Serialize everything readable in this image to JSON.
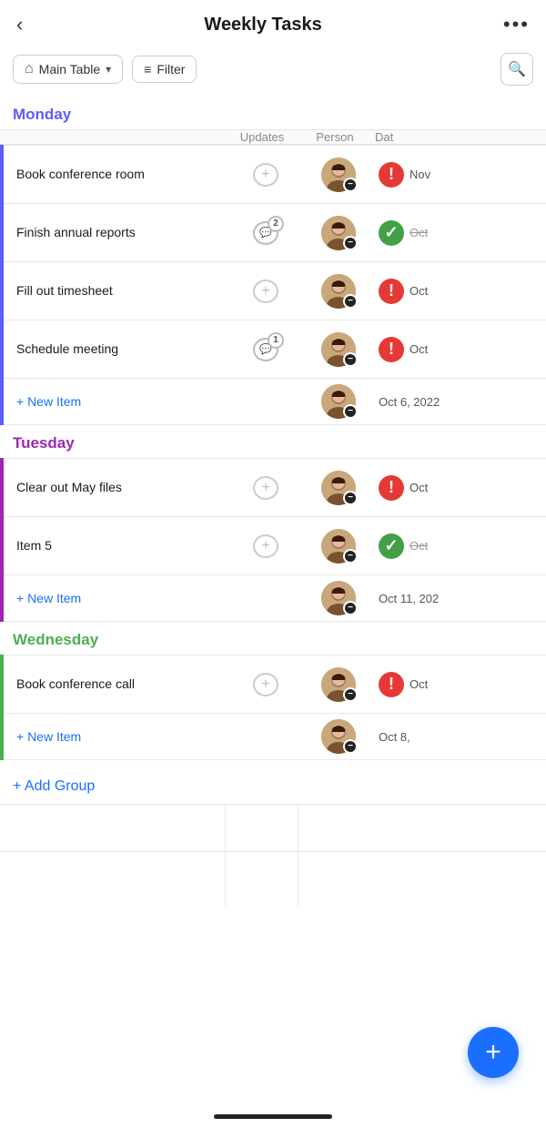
{
  "header": {
    "title": "Weekly Tasks",
    "back_label": "‹",
    "more_label": "•••"
  },
  "toolbar": {
    "table_label": "Main Table",
    "filter_label": "Filter",
    "search_icon": "search"
  },
  "columns": {
    "updates": "Updates",
    "person": "Person",
    "date": "Dat"
  },
  "groups": [
    {
      "id": "monday",
      "label": "Monday",
      "color_class": "monday",
      "items": [
        {
          "name": "Book conference room",
          "updates": 0,
          "status": "red",
          "date_text": "Nov",
          "date_strikethrough": false
        },
        {
          "name": "Finish annual reports",
          "updates": 2,
          "status": "green",
          "date_text": "Oct",
          "date_strikethrough": true
        },
        {
          "name": "Fill out timesheet",
          "updates": 0,
          "status": "red",
          "date_text": "Oct",
          "date_strikethrough": false
        },
        {
          "name": "Schedule meeting",
          "updates": 1,
          "status": "red",
          "date_text": "Oct",
          "date_strikethrough": false
        }
      ],
      "new_item_label": "+ New Item",
      "new_item_date": "Oct 6, 2022"
    },
    {
      "id": "tuesday",
      "label": "Tuesday",
      "color_class": "tuesday",
      "items": [
        {
          "name": "Clear out May files",
          "updates": 0,
          "status": "red",
          "date_text": "Oct",
          "date_strikethrough": false
        },
        {
          "name": "Item 5",
          "updates": 0,
          "status": "green",
          "date_text": "Oct",
          "date_strikethrough": true
        }
      ],
      "new_item_label": "+ New Item",
      "new_item_date": "Oct 11, 202"
    },
    {
      "id": "wednesday",
      "label": "Wednesday",
      "color_class": "wednesday",
      "items": [
        {
          "name": "Book conference call",
          "updates": 0,
          "status": "red",
          "date_text": "Oct",
          "date_strikethrough": false
        }
      ],
      "new_item_label": "+ New Item",
      "new_item_date": "Oct 8,"
    }
  ],
  "add_group_label": "+ Add Group",
  "fab_icon": "+",
  "colors": {
    "monday": "#5c5cff",
    "tuesday": "#9c27b0",
    "wednesday": "#4caf50",
    "blue": "#1a6fff",
    "red": "#e53935",
    "green": "#43a047"
  }
}
